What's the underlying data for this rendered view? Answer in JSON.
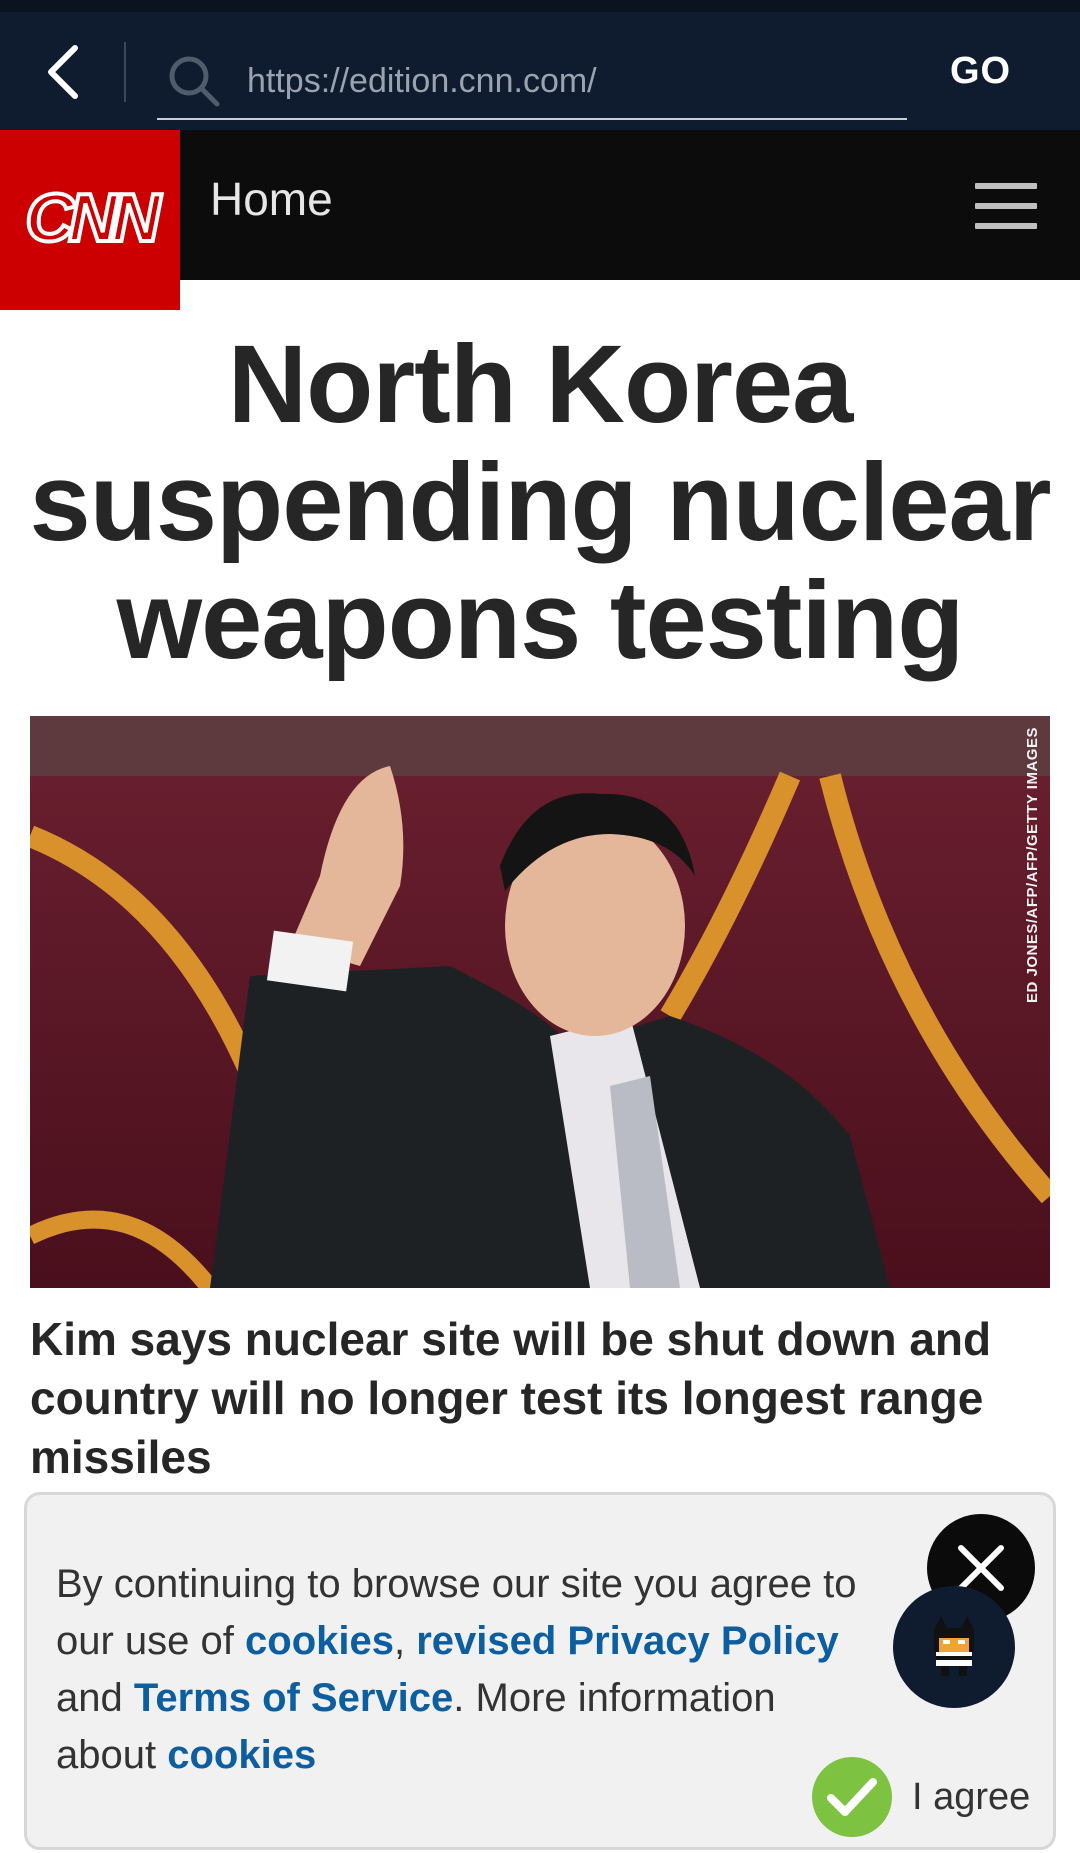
{
  "browser": {
    "url": "https://edition.cnn.com/",
    "go_label": "GO",
    "icons": {
      "back": "chevron-left-icon",
      "search": "search-icon"
    }
  },
  "site": {
    "logo_text": "CNN",
    "section_title": "Home",
    "brand_color": "#cc0000",
    "icons": {
      "menu": "hamburger-menu-icon"
    }
  },
  "article": {
    "headline": "North Korea suspending nuclear weapons testing",
    "photo_credit": "ED JONES/AFP/AFP/GETTY IMAGES",
    "summary": "Kim says nuclear site will be shut down and country will no longer test its longest range missiles"
  },
  "cookie_notice": {
    "text_1": "By continuing to browse our site you agree to our use of ",
    "link_cookies": "cookies",
    "text_2": ", ",
    "link_privacy": "revised Privacy Policy",
    "text_3": " and ",
    "link_terms": "Terms of Service",
    "text_4": ". More information about ",
    "link_more": "cookies",
    "agree_label": "I agree",
    "link_color": "#0c5ea0",
    "icons": {
      "close": "close-icon",
      "agree": "checkmark-icon",
      "assistant": "batman-mascot-icon"
    }
  }
}
